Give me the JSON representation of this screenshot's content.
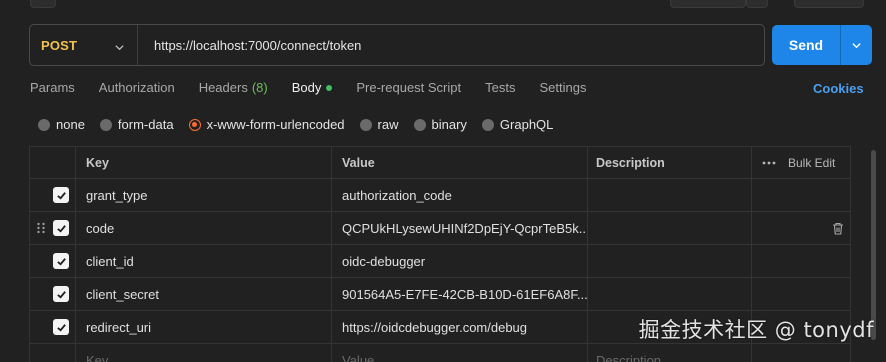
{
  "request": {
    "method": "POST",
    "url": "https://localhost:7000/connect/token",
    "send_label": "Send"
  },
  "tabs": [
    {
      "label": "Params"
    },
    {
      "label": "Authorization"
    },
    {
      "label": "Headers",
      "count": "(8)"
    },
    {
      "label": "Body",
      "active": true
    },
    {
      "label": "Pre-request Script"
    },
    {
      "label": "Tests"
    },
    {
      "label": "Settings"
    }
  ],
  "cookies_label": "Cookies",
  "body_types": [
    {
      "label": "none"
    },
    {
      "label": "form-data"
    },
    {
      "label": "x-www-form-urlencoded",
      "selected": true
    },
    {
      "label": "raw"
    },
    {
      "label": "binary"
    },
    {
      "label": "GraphQL"
    }
  ],
  "table": {
    "headers": {
      "key": "Key",
      "value": "Value",
      "description": "Description",
      "bulk_edit": "Bulk Edit"
    },
    "rows": [
      {
        "checked": true,
        "key": "grant_type",
        "value": "authorization_code",
        "description": ""
      },
      {
        "checked": true,
        "key": "code",
        "value": "QCPUkHLysewUHINf2DpEjY-QcprTeB5k...",
        "description": ""
      },
      {
        "checked": true,
        "key": "client_id",
        "value": "oidc-debugger",
        "description": ""
      },
      {
        "checked": true,
        "key": "client_secret",
        "value": "901564A5-E7FE-42CB-B10D-61EF6A8F...",
        "description": ""
      },
      {
        "checked": true,
        "key": "redirect_uri",
        "value": "https://oidcdebugger.com/debug",
        "description": ""
      }
    ],
    "placeholder": {
      "key": "Key",
      "value": "Value",
      "description": "Description"
    }
  },
  "watermark": "掘金技术社区 @ tonydf",
  "colors": {
    "accent": "#1d86e8",
    "method": "#f2c14e",
    "selected_radio": "#ff6c37",
    "link": "#4a9fef",
    "count": "#6bbf59"
  }
}
